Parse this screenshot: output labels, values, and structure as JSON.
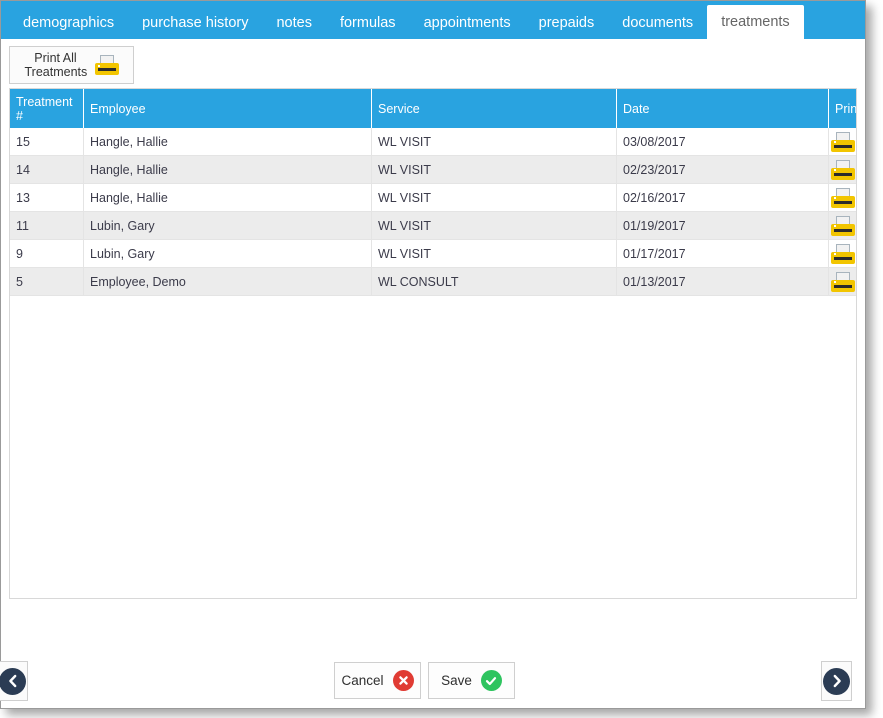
{
  "tabs": [
    {
      "label": "demographics",
      "active": false
    },
    {
      "label": "purchase history",
      "active": false
    },
    {
      "label": "notes",
      "active": false
    },
    {
      "label": "formulas",
      "active": false
    },
    {
      "label": "appointments",
      "active": false
    },
    {
      "label": "prepaids",
      "active": false
    },
    {
      "label": "documents",
      "active": false
    },
    {
      "label": "treatments",
      "active": true
    }
  ],
  "toolbar": {
    "print_all_label": "Print All Treatments",
    "print_all_icon": "printer-icon"
  },
  "grid": {
    "columns": [
      {
        "key": "treatment_no",
        "label": "Treatment #"
      },
      {
        "key": "employee",
        "label": "Employee"
      },
      {
        "key": "service",
        "label": "Service"
      },
      {
        "key": "date",
        "label": "Date"
      },
      {
        "key": "print",
        "label": "Print"
      }
    ],
    "rows": [
      {
        "treatment_no": "15",
        "employee": "Hangle, Hallie",
        "service": "WL VISIT",
        "date": "03/08/2017",
        "print_icon": "printer-icon"
      },
      {
        "treatment_no": "14",
        "employee": "Hangle, Hallie",
        "service": "WL VISIT",
        "date": "02/23/2017",
        "print_icon": "printer-icon"
      },
      {
        "treatment_no": "13",
        "employee": "Hangle, Hallie",
        "service": "WL VISIT",
        "date": "02/16/2017",
        "print_icon": "printer-icon"
      },
      {
        "treatment_no": "11",
        "employee": "Lubin, Gary",
        "service": "WL VISIT",
        "date": "01/19/2017",
        "print_icon": "printer-icon"
      },
      {
        "treatment_no": "9",
        "employee": "Lubin, Gary",
        "service": "WL VISIT",
        "date": "01/17/2017",
        "print_icon": "printer-icon"
      },
      {
        "treatment_no": "5",
        "employee": "Employee, Demo",
        "service": "WL CONSULT",
        "date": "01/13/2017",
        "print_icon": "printer-icon"
      }
    ]
  },
  "footer": {
    "cancel_label": "Cancel",
    "cancel_icon": "cancel-circle-icon",
    "save_label": "Save",
    "save_icon": "check-circle-icon"
  },
  "nav": {
    "prev_icon": "chevron-left-circle-icon",
    "next_icon": "chevron-right-circle-icon"
  },
  "colors": {
    "accent": "#29a3e0",
    "row_alt": "#ececec",
    "printer_yellow": "#f2c500",
    "cancel_red": "#e03b33",
    "save_green": "#2ec45f",
    "nav_navy": "#2b3c54"
  }
}
